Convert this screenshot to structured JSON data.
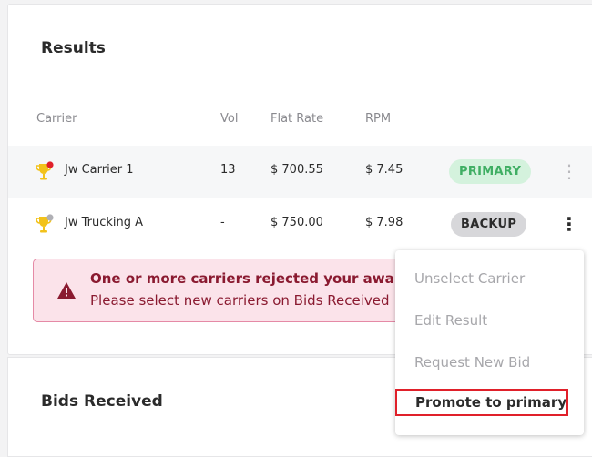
{
  "results": {
    "title": "Results",
    "columns": {
      "carrier": "Carrier",
      "vol": "Vol",
      "flat_rate": "Flat Rate",
      "rpm": "RPM"
    },
    "rows": [
      {
        "carrier": "Jw Carrier 1",
        "vol": "13",
        "flat_rate": "$ 700.55",
        "rpm": "$ 7.45",
        "badge": "PRIMARY",
        "trophy_dot_color": "#e0202a"
      },
      {
        "carrier": "Jw Trucking A",
        "vol": "-",
        "flat_rate": "$ 750.00",
        "rpm": "$ 7.98",
        "badge": "BACKUP",
        "trophy_dot_color": "#b0b0b5"
      }
    ]
  },
  "alert": {
    "title": "One or more carriers rejected your award",
    "body": "Please select new carriers on Bids Received"
  },
  "menu": {
    "items": [
      "Unselect Carrier",
      "Edit Result",
      "Request New Bid",
      "Promote to primary"
    ]
  },
  "bids": {
    "title": "Bids Received"
  },
  "colors": {
    "primary_badge_bg": "#d4f2dd",
    "primary_badge_text": "#3fae63",
    "backup_badge_bg": "#d7d7da",
    "alert_bg": "#fbe3ea",
    "alert_text": "#8a1a30",
    "highlight_border": "#e0202a"
  }
}
